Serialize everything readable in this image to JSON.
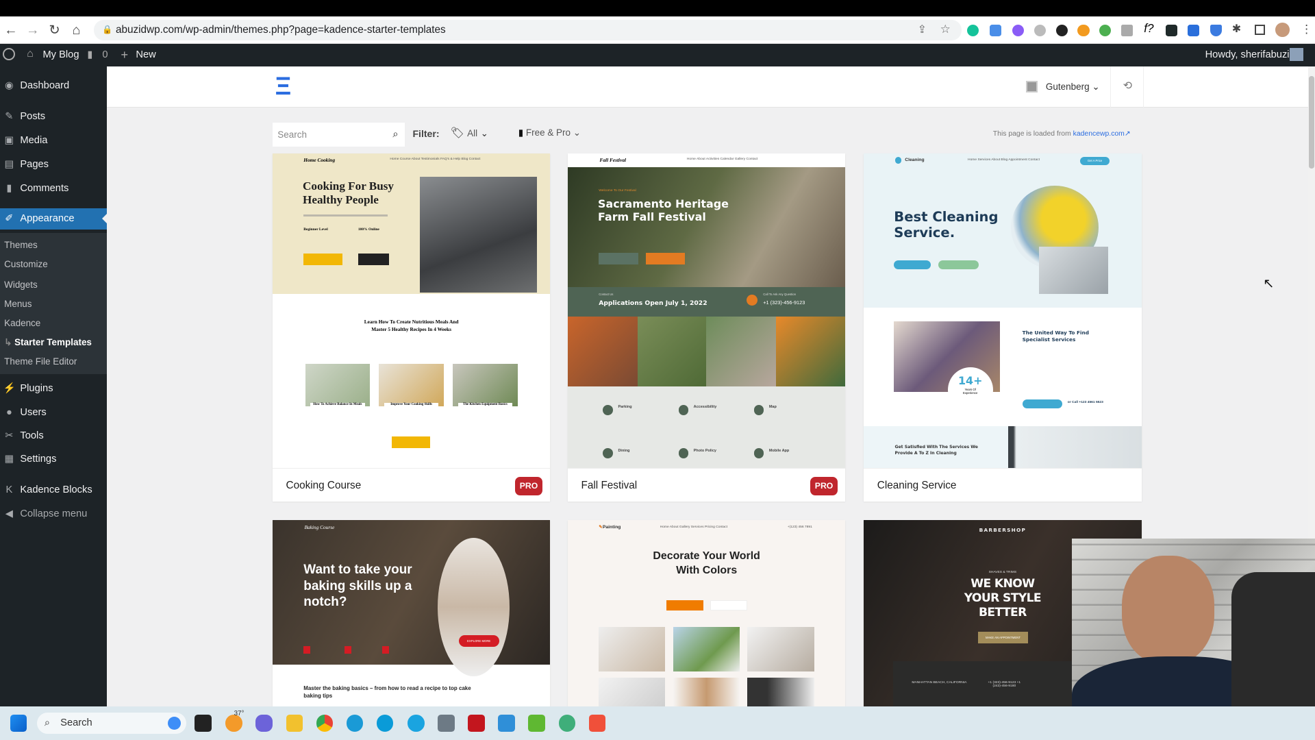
{
  "browser": {
    "url": "abuzidwp.com/wp-admin/themes.php?page=kadence-starter-templates"
  },
  "admin_bar": {
    "site_name": "My Blog",
    "comments_count": "0",
    "new_label": "New",
    "greeting": "Howdy, sherifabuzid"
  },
  "sidebar": {
    "items": [
      {
        "label": "Dashboard",
        "icon": "dashboard-icon"
      },
      {
        "label": "Posts",
        "icon": "pin-icon"
      },
      {
        "label": "Media",
        "icon": "media-icon"
      },
      {
        "label": "Pages",
        "icon": "pages-icon"
      },
      {
        "label": "Comments",
        "icon": "comment-icon"
      },
      {
        "label": "Appearance",
        "icon": "brush-icon"
      },
      {
        "label": "Plugins",
        "icon": "plug-icon"
      },
      {
        "label": "Users",
        "icon": "user-icon"
      },
      {
        "label": "Tools",
        "icon": "wrench-icon"
      },
      {
        "label": "Settings",
        "icon": "settings-icon"
      },
      {
        "label": "Kadence Blocks",
        "icon": "kadence-icon"
      },
      {
        "label": "Collapse menu",
        "icon": "collapse-icon"
      }
    ],
    "submenu": [
      "Themes",
      "Customize",
      "Widgets",
      "Menus",
      "Kadence",
      "Starter Templates",
      "Theme File Editor"
    ]
  },
  "header": {
    "builder": "Gutenberg"
  },
  "filters": {
    "search_placeholder": "Search",
    "filter_label": "Filter:",
    "category": "All",
    "plan": "Free & Pro",
    "source_note": "This page is loaded from",
    "source_link": "kadencewp.com"
  },
  "cards": [
    {
      "name": "Cooking Course",
      "badge": "PRO",
      "brand": "Home Cooking",
      "nav": "Home  Course  About  Testimonials  FAQ's & Help  Blog  Contact",
      "heading": "Cooking For Busy Healthy People",
      "sub1": "Beginner Level",
      "sub2": "100% Online",
      "section": "Learn How To Create Nutritious Meals And Master 5 Healthy Recipes In 4 Weeks",
      "items": [
        "How To Achieve Balance In Meals",
        "Improve Your Cooking Skills",
        "The Kitchen Equipment Basics"
      ]
    },
    {
      "name": "Fall Festival",
      "badge": "PRO",
      "brand": "Fall Festival",
      "nav": "Home  About  Activities  Calendar  Gallery  Contact",
      "eyebrow": "Welcome To Our Festival",
      "heading": "Sacramento Heritage Farm Fall Festival",
      "band": "Applications Open July 1, 2022",
      "band_label": "Contact Us",
      "phone_label": "Call To Ask Any Question",
      "phone": "+1 (323)-456-9123",
      "items": [
        "Parking",
        "Accessibility",
        "Map",
        "Dining",
        "Photo Policy",
        "Mobile App"
      ]
    },
    {
      "name": "Cleaning Service",
      "badge": "",
      "brand": "Cleaning",
      "nav": "Home  Services  About  Blog  Appointment  Contact",
      "cta": "Get A Price",
      "heading": "Best Cleaning Service.",
      "about": "The United Way To Find Specialist Services",
      "stat": "14+",
      "stat_label": "Years Of Experience",
      "call": "or Call +123 4561 5523",
      "services": "Get Satisfied With The Services We Provide A To Z In Cleaning"
    },
    {
      "name": "Baking Course",
      "brand": "Baking Course",
      "heading": "Want to take your baking skills up a notch?",
      "button": "EXPLORE MORE",
      "overview": "Master the baking basics – from how to read a recipe to top cake baking tips"
    },
    {
      "name": "Painting",
      "brand": "Painting",
      "nav": "Home  About  Gallery  Services  Pricing  Contact",
      "phone": "+(123) 456 7891",
      "heading": "Decorate Your World With Colors"
    },
    {
      "name": "Barbershop",
      "brand": "BARBERSHOP",
      "eyebrow": "SHAVES & TRIMS",
      "heading": "WE KNOW YOUR STYLE BETTER",
      "button": "MAKE AN APPOINTMENT",
      "address": "MANHATTAN BEACH, CALIFORNIA",
      "phones": "+1 (323)-456-9123 +1 (243)-456-9180"
    }
  ],
  "taskbar": {
    "search": "Search",
    "weather": "37°"
  },
  "colors": {
    "wp_dark": "#1d2327",
    "wp_blue": "#2271b1",
    "pro_badge": "#c0262d",
    "kadence_blue": "#2b6de0"
  }
}
